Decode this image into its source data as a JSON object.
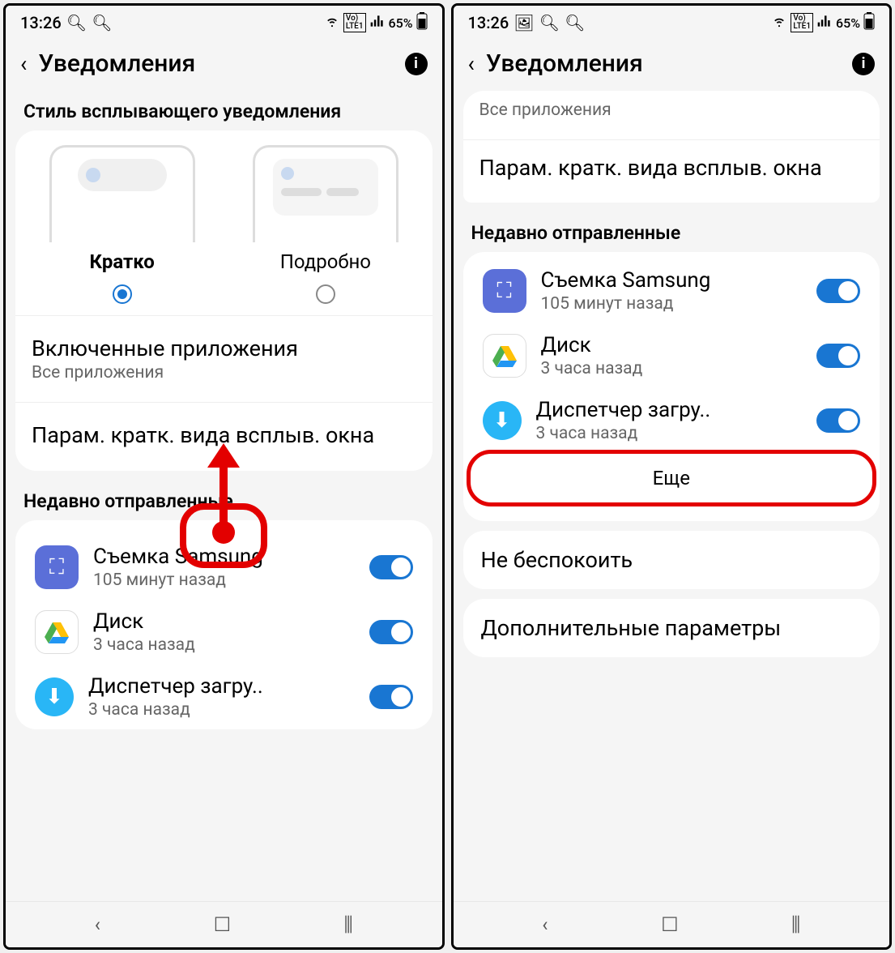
{
  "status": {
    "time": "13:26",
    "battery": "65%",
    "lte": "LTE1",
    "vo": "Vo)"
  },
  "header": {
    "title": "Уведомления"
  },
  "left": {
    "section_style": "Стиль всплывающего уведомления",
    "style_short": "Кратко",
    "style_detail": "Подробно",
    "included_title": "Включенные приложения",
    "included_sub": "Все приложения",
    "brief_params": "Парам. кратк. вида всплыв. окна",
    "recent_header": "Недавно отправленные",
    "apps": [
      {
        "name": "Съемка Samsung",
        "time": "105 минут назад"
      },
      {
        "name": "Диск",
        "time": "3 часа назад"
      },
      {
        "name": "Диспетчер загру..",
        "time": "3 часа назад"
      }
    ]
  },
  "right": {
    "all_apps": "Все приложения",
    "brief_params": "Парам. кратк. вида всплыв. окна",
    "recent_header": "Недавно отправленные",
    "apps": [
      {
        "name": "Съемка Samsung",
        "time": "105 минут назад"
      },
      {
        "name": "Диск",
        "time": "3 часа назад"
      },
      {
        "name": "Диспетчер загру..",
        "time": "3 часа назад"
      }
    ],
    "more": "Еще",
    "dnd": "Не беспокоить",
    "advanced": "Дополнительные параметры"
  }
}
